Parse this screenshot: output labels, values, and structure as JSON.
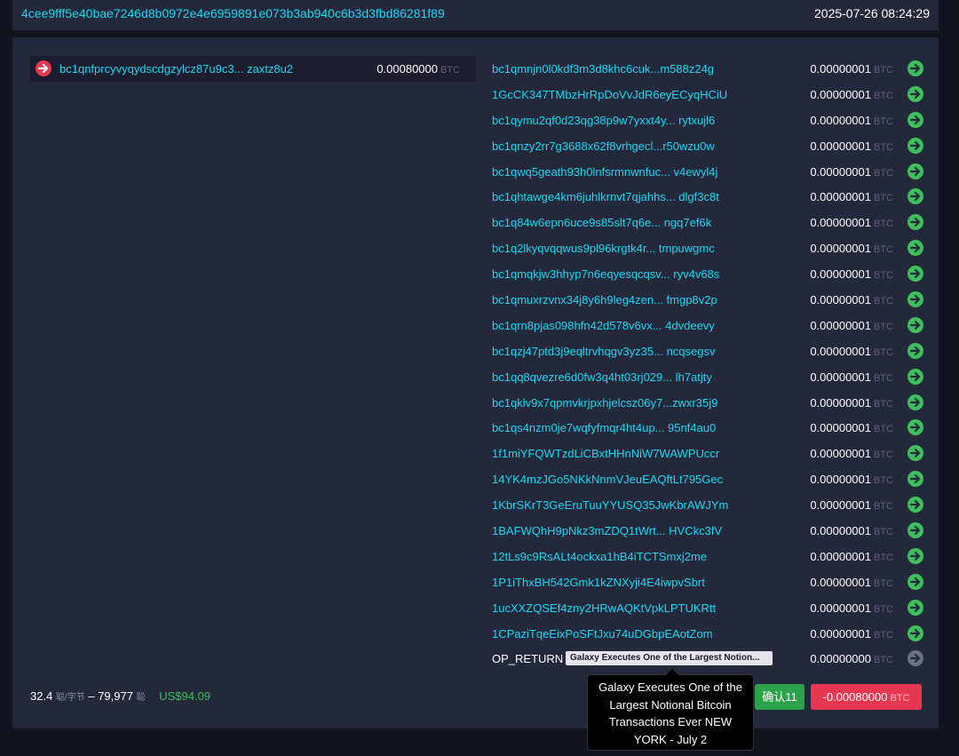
{
  "header": {
    "tx_id": "4cee9fff5e40bae7246d8b0972e4e6959891e073b3ab940c6b3d3fbd86281f89",
    "timestamp": "2025-07-26 08:24:29"
  },
  "input": {
    "address": "bc1qnfprcyvyqydscdgzylcz87u9c3... zaxtz8u2",
    "amount": "0.00080000",
    "unit": "BTC",
    "icon": "arrow-right-icon"
  },
  "outputs": [
    {
      "address": "bc1qmnjn0l0kdf3m3d8khc6cuk...m588z24g",
      "amount": "0.00000001",
      "unit": "BTC"
    },
    {
      "address": "1GcCK347TMbzHrRpDoVvJdR6eyECyqHCiU",
      "amount": "0.00000001",
      "unit": "BTC"
    },
    {
      "address": "bc1qymu2qf0d23qg38p9w7yxxt4y... rytxujl6",
      "amount": "0.00000001",
      "unit": "BTC"
    },
    {
      "address": "bc1qnzy2rr7g3688x62f8vrhgecl...r50wzu0w",
      "amount": "0.00000001",
      "unit": "BTC"
    },
    {
      "address": "bc1qwq5geath93h0lnfsrmnwnfuc... v4ewyl4j",
      "amount": "0.00000001",
      "unit": "BTC"
    },
    {
      "address": "bc1qhtawge4km6juhlkrnvt7qjahhs... dlgf3c8t",
      "amount": "0.00000001",
      "unit": "BTC"
    },
    {
      "address": "bc1q84w6epn6uce9s85slt7q6e...  ngq7ef6k",
      "amount": "0.00000001",
      "unit": "BTC"
    },
    {
      "address": "bc1q2lkyqvqqwus9pl96krgtk4r...  tmpuwgmc",
      "amount": "0.00000001",
      "unit": "BTC"
    },
    {
      "address": "bc1qmqkjw3hhyp7n6eqyesqcqsv... ryv4v68s",
      "amount": "0.00000001",
      "unit": "BTC"
    },
    {
      "address": "bc1qmuxrzvnx34j8y6h9leg4zen... fmgp8v2p",
      "amount": "0.00000001",
      "unit": "BTC"
    },
    {
      "address": "bc1qrn8pjas098hfn42d578v6vx...  4dvdeevy",
      "amount": "0.00000001",
      "unit": "BTC"
    },
    {
      "address": "bc1qzj47ptd3j9eqltrvhqgv3yz35... ncqsegsv",
      "amount": "0.00000001",
      "unit": "BTC"
    },
    {
      "address": "bc1qq8qvezre6d0fw3q4ht03rj029...  lh7atjty",
      "amount": "0.00000001",
      "unit": "BTC"
    },
    {
      "address": "bc1qklv9x7qpmvkrjpxhjelcsz06y7...zwxr35j9",
      "amount": "0.00000001",
      "unit": "BTC"
    },
    {
      "address": "bc1qs4nzm0je7wqfyfmqr4ht4up... 95nf4au0",
      "amount": "0.00000001",
      "unit": "BTC"
    },
    {
      "address": "1f1miYFQWTzdLiCBxtHHnNiW7WAWPUccr",
      "amount": "0.00000001",
      "unit": "BTC"
    },
    {
      "address": "14YK4mzJGo5NKkNnmVJeuEAQftLt795Gec",
      "amount": "0.00000001",
      "unit": "BTC"
    },
    {
      "address": "1KbrSKrT3GeEruTuuYYUSQ35JwKbrAWJYm",
      "amount": "0.00000001",
      "unit": "BTC"
    },
    {
      "address": "1BAFWQhH9pNkz3mZDQ1tWrt...  HVCkc3fV",
      "amount": "0.00000001",
      "unit": "BTC"
    },
    {
      "address": "12tLs9c9RsALt4ockxa1hB4iTCTSmxj2me",
      "amount": "0.00000001",
      "unit": "BTC"
    },
    {
      "address": "1P1iThxBH542Gmk1kZNXyji4E4iwpvSbrt",
      "amount": "0.00000001",
      "unit": "BTC"
    },
    {
      "address": "1ucXXZQSEf4zny2HRwAQKtVpkLPTUKRtt",
      "amount": "0.00000001",
      "unit": "BTC"
    },
    {
      "address": "1CPaziTqeEixPoSFtJxu74uDGbpEAotZom",
      "amount": "0.00000001",
      "unit": "BTC"
    }
  ],
  "op_return": {
    "label": "OP_RETURN",
    "message": "Galaxy Executes One of the Largest Notion...",
    "amount": "0.00000000",
    "unit": "BTC"
  },
  "footer": {
    "fee_rate": "32.4",
    "fee_rate_unit": "聪/字节",
    "separator": " – ",
    "fee_total": "79,977",
    "fee_total_unit": "聪",
    "fee_usd": "US$94.09",
    "confirmations": "确认11",
    "net_amount": "-0.00080000",
    "net_unit": "BTC"
  },
  "tooltip": {
    "text": "Galaxy Executes One of the Largest Notional Bitcoin Transactions Ever NEW YORK - July 2"
  },
  "colors": {
    "background": "#11131f",
    "panel": "#24283b",
    "link": "#1bd8f4",
    "input_icon": "#e73650",
    "output_icon": "#3cc05a",
    "confirm": "#2ba34a",
    "negative": "#e73650"
  }
}
